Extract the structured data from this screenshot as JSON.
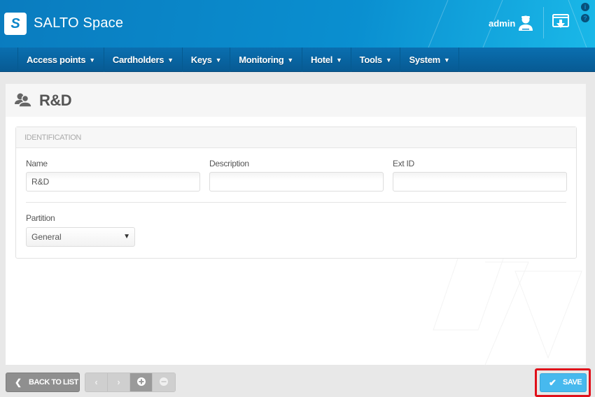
{
  "app": {
    "logo_letter": "S",
    "brand": "SALTO Space"
  },
  "header": {
    "user": "admin",
    "info_glyph": "i",
    "help_glyph": "?"
  },
  "nav": {
    "items": [
      {
        "label": "Access points"
      },
      {
        "label": "Cardholders"
      },
      {
        "label": "Keys"
      },
      {
        "label": "Monitoring"
      },
      {
        "label": "Hotel"
      },
      {
        "label": "Tools"
      },
      {
        "label": "System"
      }
    ],
    "caret": "⌄"
  },
  "page": {
    "title": "R&D",
    "icon": "user-group-icon"
  },
  "identification": {
    "section_title": "IDENTIFICATION",
    "name_label": "Name",
    "name_value": "R&D",
    "description_label": "Description",
    "description_value": "",
    "ext_id_label": "Ext ID",
    "ext_id_value": "",
    "partition_label": "Partition",
    "partition_value": "General"
  },
  "footer": {
    "back_label": "BACK TO LIST",
    "save_label": "SAVE",
    "prev_glyph": "‹",
    "next_glyph": "›",
    "accent_color": "#47b9ee",
    "highlight_color": "#e0101a"
  }
}
